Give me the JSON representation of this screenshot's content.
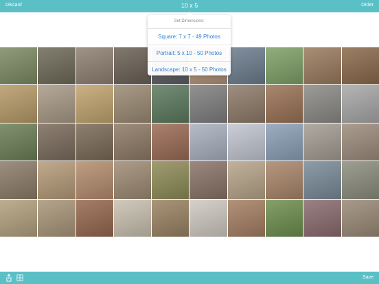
{
  "toolbar": {
    "discard": "Discard",
    "title": "10 x 5",
    "order": "Order"
  },
  "popover": {
    "header": "Set Dimensions:",
    "options": [
      "Square: 7 x 7   - 49 Photos",
      "Portrait: 5 x 10   - 50 Photos",
      "Landscape: 10 x 5   - 50 Photos"
    ]
  },
  "grid": {
    "rows": 5,
    "cols": 10,
    "colors": [
      "#7c8a63",
      "#6e6a58",
      "#8f7f72",
      "#6b6155",
      "#5b5d62",
      "#b0927a",
      "#6d7d8e",
      "#7fa067",
      "#9a7b5e",
      "#8a6a4b",
      "#b79a68",
      "#a99a88",
      "#c1a46f",
      "#9a8a72",
      "#5c7a5e",
      "#7f7f7f",
      "#8e7b6a",
      "#9b7255",
      "#8c8a85",
      "#a8a8a8",
      "#6c7f57",
      "#7b6b5c",
      "#7b6a56",
      "#8e7a66",
      "#9c6b56",
      "#a9b1bf",
      "#c2c6d1",
      "#8ba0b7",
      "#a39d93",
      "#9d8c7d",
      "#8d7c69",
      "#b69b79",
      "#b58d6e",
      "#9e8b74",
      "#8e8c57",
      "#8a7469",
      "#b7a58a",
      "#a9866a",
      "#7a8b99",
      "#8c8e7e",
      "#b3a17e",
      "#a9967a",
      "#96684e",
      "#c9c1b1",
      "#9a8363",
      "#cfcac2",
      "#a57f63",
      "#6f8f4f",
      "#8a6c6f",
      "#9a8a77"
    ]
  },
  "bottom": {
    "save": "Save",
    "icons": [
      "share-icon",
      "grid-icon"
    ]
  }
}
